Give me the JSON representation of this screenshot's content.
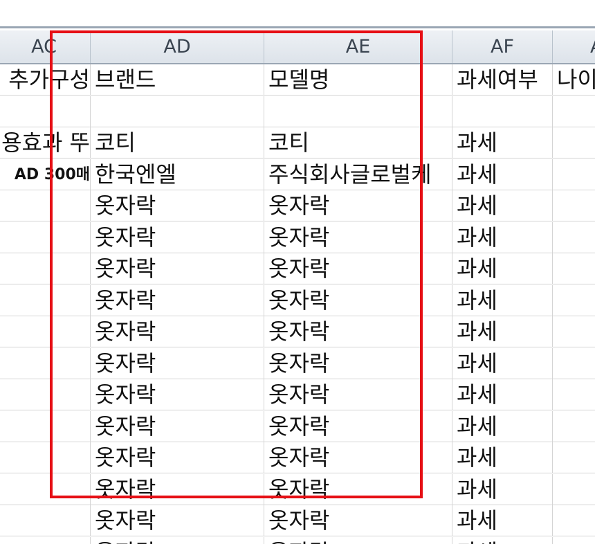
{
  "columns": [
    {
      "label": "AC"
    },
    {
      "label": "AD"
    },
    {
      "label": "AE"
    },
    {
      "label": "AF"
    },
    {
      "label": "A"
    }
  ],
  "rows": [
    {
      "ac": "추가구성",
      "ad": "브랜드",
      "ae": "모델명",
      "af": "과세여부",
      "ag": "나이"
    },
    {
      "ac": "",
      "ad": "",
      "ae": "",
      "af": "",
      "ag": ""
    },
    {
      "ac": "용효과 뚜",
      "ad": "코티",
      "ae": "코티",
      "af": "과세",
      "ag": ""
    },
    {
      "ac": "AD 300매",
      "ad": "한국엔엘",
      "ae": "주식회사글로벌케",
      "af": "과세",
      "ag": ""
    },
    {
      "ac": "",
      "ad": "옷자락",
      "ae": "옷자락",
      "af": "과세",
      "ag": ""
    },
    {
      "ac": "",
      "ad": "옷자락",
      "ae": "옷자락",
      "af": "과세",
      "ag": ""
    },
    {
      "ac": "",
      "ad": "옷자락",
      "ae": "옷자락",
      "af": "과세",
      "ag": ""
    },
    {
      "ac": "",
      "ad": "옷자락",
      "ae": "옷자락",
      "af": "과세",
      "ag": ""
    },
    {
      "ac": "",
      "ad": "옷자락",
      "ae": "옷자락",
      "af": "과세",
      "ag": ""
    },
    {
      "ac": "",
      "ad": "옷자락",
      "ae": "옷자락",
      "af": "과세",
      "ag": ""
    },
    {
      "ac": "",
      "ad": "옷자락",
      "ae": "옷자락",
      "af": "과세",
      "ag": ""
    },
    {
      "ac": "",
      "ad": "옷자락",
      "ae": "옷자락",
      "af": "과세",
      "ag": ""
    },
    {
      "ac": "",
      "ad": "옷자락",
      "ae": "옷자락",
      "af": "과세",
      "ag": ""
    },
    {
      "ac": "",
      "ad": "옷자락",
      "ae": "옷자락",
      "af": "과세",
      "ag": ""
    },
    {
      "ac": "",
      "ad": "옷자락",
      "ae": "옷자락",
      "af": "과세",
      "ag": ""
    },
    {
      "ac": "",
      "ad": "옷자락",
      "ae": "옷자락",
      "af": "과세",
      "ag": ""
    }
  ],
  "highlight": {
    "color": "#e60f15"
  }
}
